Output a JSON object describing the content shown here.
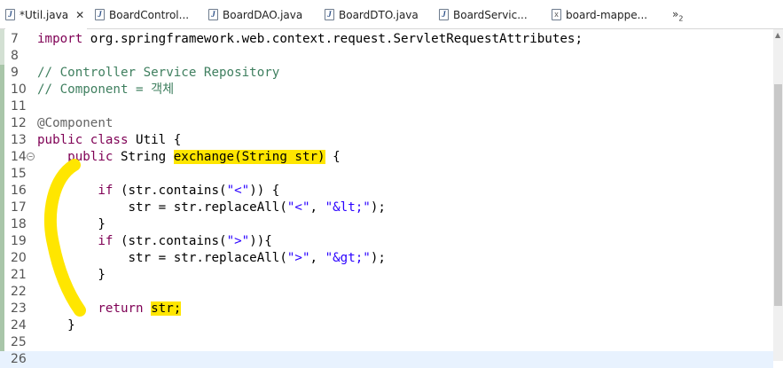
{
  "tabs": [
    {
      "label": "*Util.java",
      "icon": "java-file-icon",
      "active": true,
      "close": "✕"
    },
    {
      "label": "BoardControl...",
      "icon": "java-file-icon"
    },
    {
      "label": "BoardDAO.java",
      "icon": "java-file-icon"
    },
    {
      "label": "BoardDTO.java",
      "icon": "java-file-icon"
    },
    {
      "label": "BoardServic...",
      "icon": "java-file-icon"
    },
    {
      "label": "board-mappe...",
      "icon": "xml-file-icon"
    }
  ],
  "overflow": {
    "label": "»",
    "count": "2"
  },
  "lines": [
    {
      "n": "7",
      "parts": [
        {
          "t": "import",
          "c": "kw"
        },
        {
          "t": " org.springframework.web.context.request.ServletRequestAttributes;"
        }
      ]
    },
    {
      "n": "8",
      "parts": []
    },
    {
      "n": "9",
      "parts": [
        {
          "t": "// Controller Service Repository",
          "c": "cm"
        }
      ]
    },
    {
      "n": "10",
      "parts": [
        {
          "t": "// Component = 객체",
          "c": "cm"
        }
      ]
    },
    {
      "n": "11",
      "parts": []
    },
    {
      "n": "12",
      "parts": [
        {
          "t": "@Component",
          "c": "an"
        }
      ]
    },
    {
      "n": "13",
      "parts": [
        {
          "t": "public class",
          "c": "kw"
        },
        {
          "t": " Util {"
        }
      ]
    },
    {
      "n": "14",
      "fold": true,
      "parts": [
        {
          "t": "    "
        },
        {
          "t": "public",
          "c": "kw"
        },
        {
          "t": " String "
        },
        {
          "t": "exchange(String str)",
          "c": "hl"
        },
        {
          "t": " {"
        }
      ]
    },
    {
      "n": "15",
      "parts": []
    },
    {
      "n": "16",
      "parts": [
        {
          "t": "        "
        },
        {
          "t": "if",
          "c": "kw"
        },
        {
          "t": " (str.contains("
        },
        {
          "t": "\"<\"",
          "c": "st"
        },
        {
          "t": ")) {"
        }
      ]
    },
    {
      "n": "17",
      "parts": [
        {
          "t": "            str = str.replaceAll("
        },
        {
          "t": "\"<\"",
          "c": "st"
        },
        {
          "t": ", "
        },
        {
          "t": "\"&lt;\"",
          "c": "st"
        },
        {
          "t": ");"
        }
      ]
    },
    {
      "n": "18",
      "parts": [
        {
          "t": "        }"
        }
      ]
    },
    {
      "n": "19",
      "parts": [
        {
          "t": "        "
        },
        {
          "t": "if",
          "c": "kw"
        },
        {
          "t": " (str.contains("
        },
        {
          "t": "\">\"",
          "c": "st"
        },
        {
          "t": ")){"
        }
      ]
    },
    {
      "n": "20",
      "parts": [
        {
          "t": "            str = str.replaceAll("
        },
        {
          "t": "\">\"",
          "c": "st"
        },
        {
          "t": ", "
        },
        {
          "t": "\"&gt;\"",
          "c": "st"
        },
        {
          "t": ");"
        }
      ]
    },
    {
      "n": "21",
      "parts": [
        {
          "t": "        }"
        }
      ]
    },
    {
      "n": "22",
      "parts": []
    },
    {
      "n": "23",
      "parts": [
        {
          "t": "        "
        },
        {
          "t": "return",
          "c": "kw"
        },
        {
          "t": " "
        },
        {
          "t": "str;",
          "c": "hl"
        }
      ]
    },
    {
      "n": "24",
      "parts": [
        {
          "t": "    }"
        }
      ]
    },
    {
      "n": "25",
      "parts": []
    },
    {
      "n": "26",
      "current": true,
      "parts": []
    }
  ]
}
